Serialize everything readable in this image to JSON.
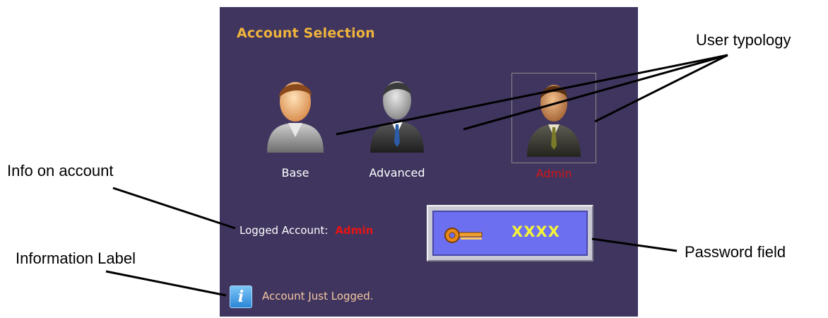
{
  "panel": {
    "title": "Account Selection",
    "users": [
      {
        "label": "Base"
      },
      {
        "label": "Advanced"
      },
      {
        "label": "Admin"
      }
    ],
    "logged_label": "Logged Account:",
    "logged_value": "Admin",
    "password_value": "XXXX",
    "info_icon_glyph": "i",
    "info_text": "Account Just Logged."
  },
  "annotations": {
    "user_typology": "User typology",
    "info_on_account": "Info on account",
    "information_label": "Information Label",
    "password_field": "Password field"
  },
  "colors": {
    "panel_bg": "#40355f",
    "title": "#f0b43c",
    "admin_red": "#d41515",
    "password_text": "#f3f33a",
    "password_bg": "#6c6ff0"
  }
}
